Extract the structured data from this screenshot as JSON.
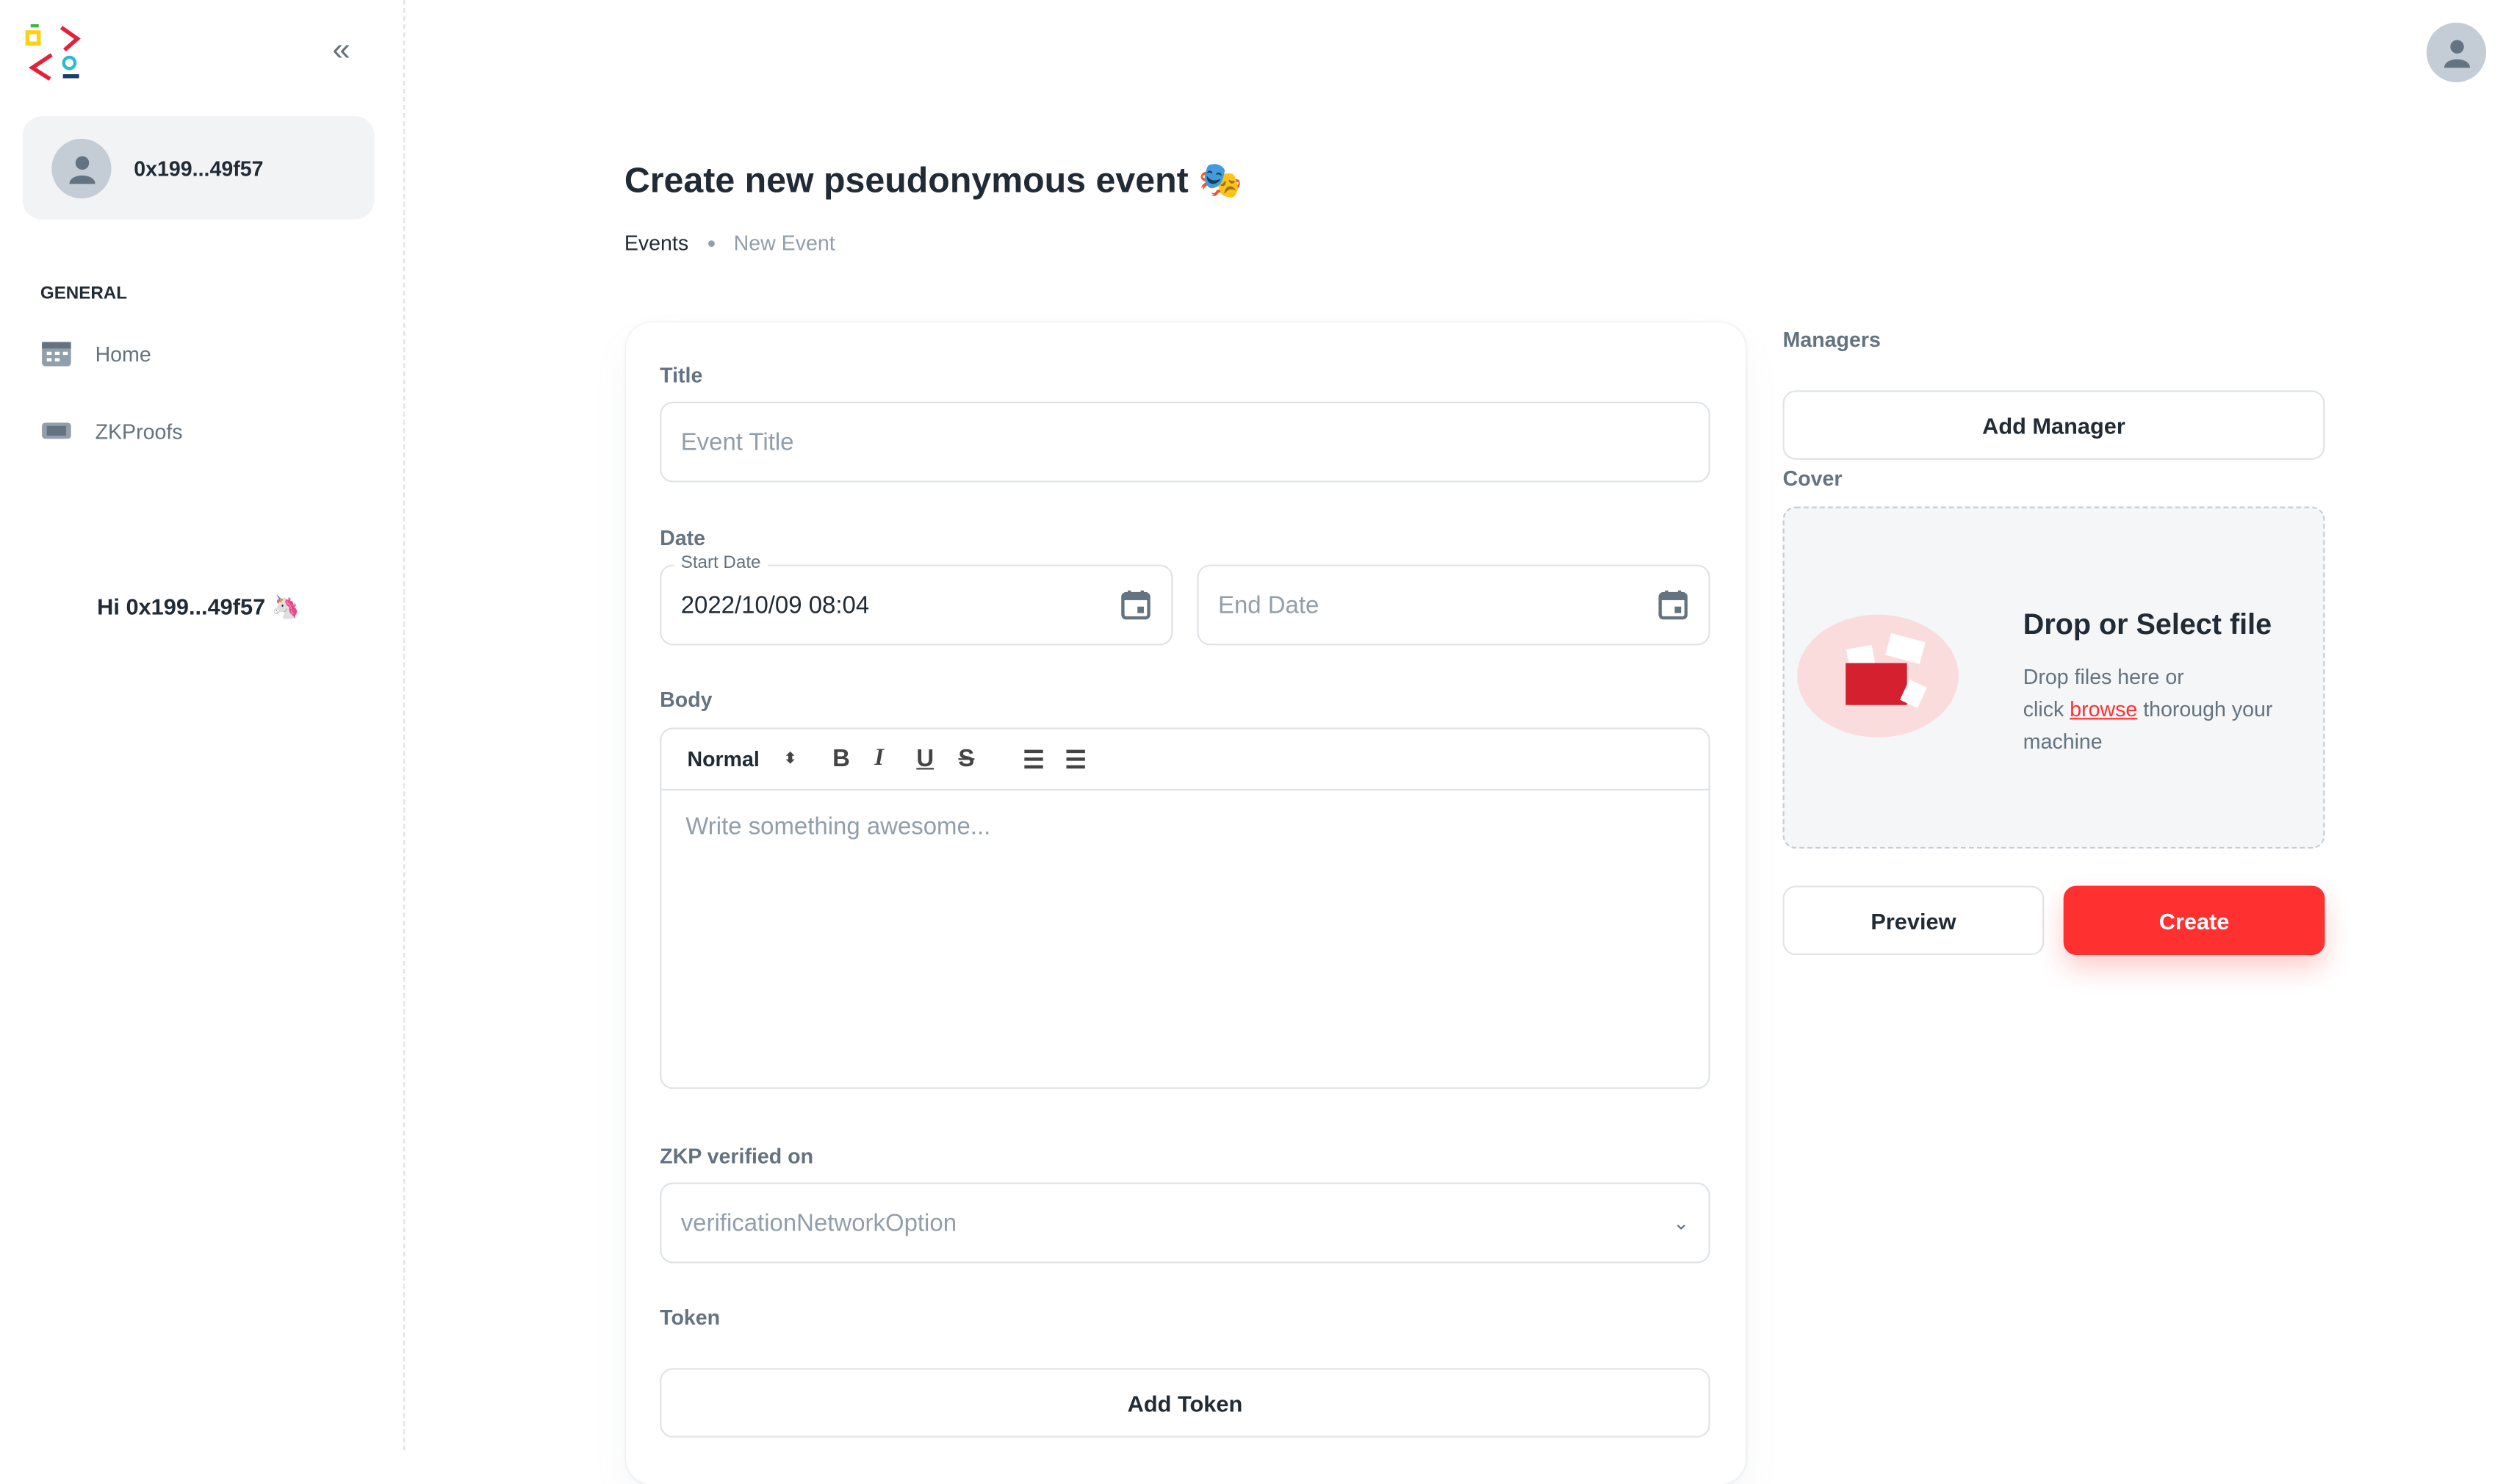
{
  "sidebar": {
    "account": "0x199...49f57",
    "section": "GENERAL",
    "items": [
      {
        "label": "Home",
        "icon": "calendar-icon"
      },
      {
        "label": "ZKProofs",
        "icon": "ticket-icon"
      }
    ],
    "greeting": "Hi 0x199...49f57 🦄"
  },
  "header": {
    "title": "Create new pseudonymous event 🎭",
    "breadcrumb": [
      "Events",
      "New Event"
    ]
  },
  "form": {
    "title_label": "Title",
    "title_placeholder": "Event Title",
    "date_label": "Date",
    "start_label": "Start Date",
    "start_value": "2022/10/09 08:04",
    "end_placeholder": "End Date",
    "body_label": "Body",
    "format": "Normal",
    "body_placeholder": "Write something awesome...",
    "zkp_label": "ZKP verified on",
    "zkp_value": "verificationNetworkOption",
    "token_label": "Token",
    "add_token": "Add Token"
  },
  "side": {
    "managers_label": "Managers",
    "add_manager": "Add Manager",
    "cover_label": "Cover",
    "drop_title": "Drop or Select file",
    "drop_text1": "Drop files here or",
    "drop_click": "click ",
    "drop_browse": "browse",
    "drop_text2": " thorough your machine",
    "preview": "Preview",
    "create": "Create"
  },
  "colors": {
    "accent": "#ff3030",
    "text": "#212b36",
    "muted": "#637381"
  }
}
